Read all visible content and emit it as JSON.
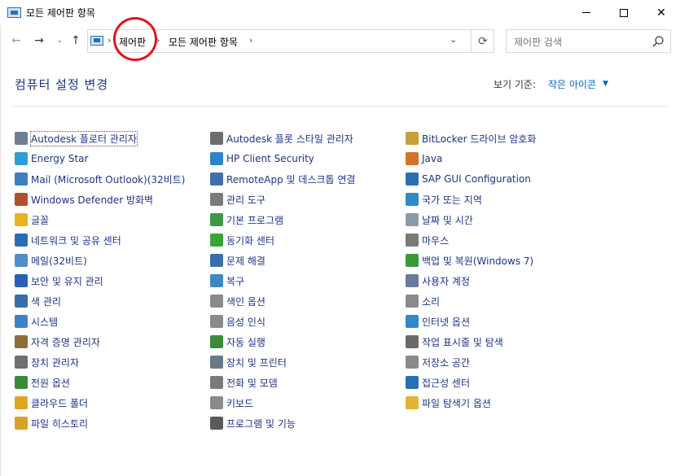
{
  "window": {
    "title": "모든 제어판 항목",
    "min": "–",
    "max": "□",
    "close": "✕"
  },
  "nav": {
    "back": "←",
    "forward": "→",
    "recent": "⌄",
    "up": "↑"
  },
  "address": {
    "sep1": "›",
    "crumb1": "제어판",
    "sep2": "›",
    "crumb2": "모든 제어판 항목",
    "sep3": "›",
    "dropdown": "⌄",
    "refresh": "⟳"
  },
  "search": {
    "placeholder": "제어판 검색"
  },
  "header": {
    "title": "컴퓨터 설정 변경",
    "view_label": "보기 기준:",
    "view_value": "작은 아이콘",
    "view_caret": "▼"
  },
  "columns": [
    [
      {
        "label": "Autodesk 플로터 관리자",
        "icon": "plotter-icon",
        "color": "#6e7f90"
      },
      {
        "label": "Energy Star",
        "icon": "energy-star-icon",
        "color": "#2f9bd7"
      },
      {
        "label": "Mail (Microsoft Outlook)(32비트)",
        "icon": "mail-icon",
        "color": "#3f7fbf"
      },
      {
        "label": "Windows Defender 방화벽",
        "icon": "firewall-icon",
        "color": "#b0502c"
      },
      {
        "label": "글꼴",
        "icon": "font-icon",
        "color": "#e6b422"
      },
      {
        "label": "네트워크 및 공유 센터",
        "icon": "network-icon",
        "color": "#2a6fb5"
      },
      {
        "label": "메일(32비트)",
        "icon": "mail32-icon",
        "color": "#4f8ec9"
      },
      {
        "label": "보안 및 유지 관리",
        "icon": "flag-icon",
        "color": "#2a5fb5"
      },
      {
        "label": "색 관리",
        "icon": "color-management-icon",
        "color": "#3a6ea8"
      },
      {
        "label": "시스템",
        "icon": "system-icon",
        "color": "#3d82c4"
      },
      {
        "label": "자격 증명 관리자",
        "icon": "credential-icon",
        "color": "#8a6e3c"
      },
      {
        "label": "장치 관리자",
        "icon": "device-manager-icon",
        "color": "#6f6f6f"
      },
      {
        "label": "전원 옵션",
        "icon": "power-icon",
        "color": "#3a8a3a"
      },
      {
        "label": "클라우드 폴더",
        "icon": "cloud-folder-icon",
        "color": "#e1a526"
      },
      {
        "label": "파일 히스토리",
        "icon": "file-history-icon",
        "color": "#d9a12a"
      }
    ],
    [
      {
        "label": "Autodesk 플롯 스타일 관리자",
        "icon": "plot-style-icon",
        "color": "#6e6e6e"
      },
      {
        "label": "HP Client Security",
        "icon": "hp-security-icon",
        "color": "#2a86c8"
      },
      {
        "label": "RemoteApp 및 데스크톱 연결",
        "icon": "remoteapp-icon",
        "color": "#3f6fb0"
      },
      {
        "label": "관리 도구",
        "icon": "admin-tools-icon",
        "color": "#7a7a7a"
      },
      {
        "label": "기본 프로그램",
        "icon": "default-programs-icon",
        "color": "#3a9a4a"
      },
      {
        "label": "동기화 센터",
        "icon": "sync-center-icon",
        "color": "#3aa43a"
      },
      {
        "label": "문제 해결",
        "icon": "troubleshoot-icon",
        "color": "#3a6ea8"
      },
      {
        "label": "복구",
        "icon": "recovery-icon",
        "color": "#3a8ac4"
      },
      {
        "label": "색인 옵션",
        "icon": "indexing-icon",
        "color": "#8a8a8a"
      },
      {
        "label": "음성 인식",
        "icon": "microphone-icon",
        "color": "#8a8a8a"
      },
      {
        "label": "자동 실행",
        "icon": "autoplay-icon",
        "color": "#3a8a3a"
      },
      {
        "label": "장치 및 프린터",
        "icon": "printer-icon",
        "color": "#6a7a8a"
      },
      {
        "label": "전화 및 모뎀",
        "icon": "phone-modem-icon",
        "color": "#7a7a7a"
      },
      {
        "label": "키보드",
        "icon": "keyboard-icon",
        "color": "#8a8a8a"
      },
      {
        "label": "프로그램 및 기능",
        "icon": "programs-icon",
        "color": "#5a5a5a"
      }
    ],
    [
      {
        "label": "BitLocker 드라이브 암호화",
        "icon": "bitlocker-icon",
        "color": "#c8a03a"
      },
      {
        "label": "Java",
        "icon": "java-icon",
        "color": "#d2732a"
      },
      {
        "label": "SAP GUI Configuration",
        "icon": "sap-icon",
        "color": "#2a6fb5"
      },
      {
        "label": "국가 또는 지역",
        "icon": "region-icon",
        "color": "#2f8ac9"
      },
      {
        "label": "날짜 및 시간",
        "icon": "date-time-icon",
        "color": "#8a9aaa"
      },
      {
        "label": "마우스",
        "icon": "mouse-icon",
        "color": "#7a7a7a"
      },
      {
        "label": "백업 및 복원(Windows 7)",
        "icon": "backup-icon",
        "color": "#3a9a3a"
      },
      {
        "label": "사용자 계정",
        "icon": "user-accounts-icon",
        "color": "#6a7a9a"
      },
      {
        "label": "소리",
        "icon": "sound-icon",
        "color": "#8a8a8a"
      },
      {
        "label": "인터넷 옵션",
        "icon": "internet-options-icon",
        "color": "#2f8ac9"
      },
      {
        "label": "작업 표시줄 및 탐색",
        "icon": "taskbar-icon",
        "color": "#6a6a6a"
      },
      {
        "label": "저장소 공간",
        "icon": "storage-spaces-icon",
        "color": "#8a8a8a"
      },
      {
        "label": "접근성 센터",
        "icon": "ease-of-access-icon",
        "color": "#2a6fb5"
      },
      {
        "label": "파일 탐색기 옵션",
        "icon": "explorer-options-icon",
        "color": "#e1b436"
      }
    ]
  ]
}
